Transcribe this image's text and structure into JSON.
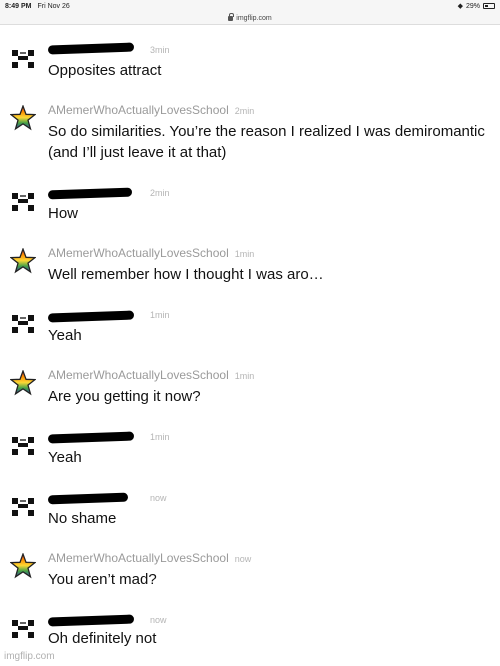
{
  "status_bar": {
    "time": "8:49 PM",
    "date": "Fri Nov 26",
    "battery": "29%"
  },
  "url_bar": {
    "domain": "imgflip.com"
  },
  "messages": [
    {
      "author": "",
      "time": "3min",
      "text": "Opposites attract",
      "avatar": "pixel-face-icon"
    },
    {
      "author": "AMemerWhoActuallyLovesSchool",
      "time": "2min",
      "text": "So do similarities. You’re the reason I realized I was demiromantic",
      "text2": "(and I’ll just leave it at that)",
      "avatar": "rainbow-star-icon"
    },
    {
      "author": "",
      "time": "2min",
      "text": "How",
      "avatar": "pixel-face-icon"
    },
    {
      "author": "AMemerWhoActuallyLovesSchool",
      "time": "1min",
      "text": "Well remember how I thought I was aro…",
      "avatar": "rainbow-star-icon"
    },
    {
      "author": "",
      "time": "1min",
      "text": "Yeah",
      "avatar": "pixel-face-icon"
    },
    {
      "author": "AMemerWhoActuallyLovesSchool",
      "time": "1min",
      "text": "Are you getting it now?",
      "avatar": "rainbow-star-icon"
    },
    {
      "author": "",
      "time": "1min",
      "text": "Yeah",
      "avatar": "pixel-face-icon"
    },
    {
      "author": "",
      "time": "now",
      "text": "No shame",
      "avatar": "pixel-face-icon"
    },
    {
      "author": "AMemerWhoActuallyLovesSchool",
      "time": "now",
      "text": "You aren’t mad?",
      "avatar": "rainbow-star-icon"
    },
    {
      "author": "",
      "time": "now",
      "text": "Oh definitely not",
      "avatar": "pixel-face-icon"
    }
  ],
  "watermark": "imgflip.com",
  "colors": {
    "name": "#9a9a9a",
    "text": "#111111",
    "redaction": "#000000"
  }
}
